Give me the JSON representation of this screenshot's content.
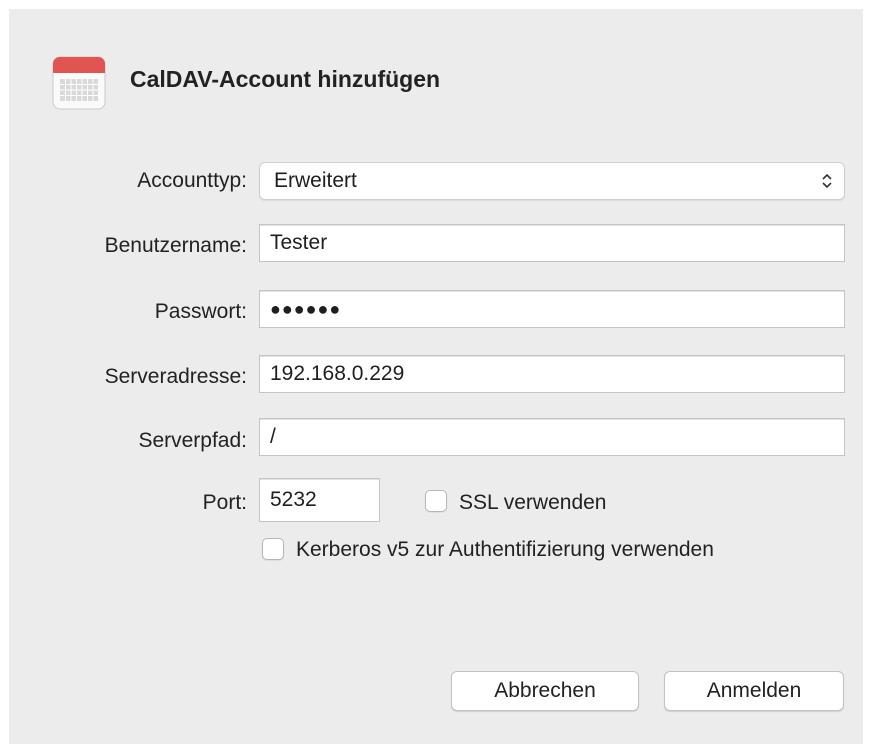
{
  "dialog": {
    "title": "CalDAV-Account hinzufügen",
    "icon": "calendar-icon"
  },
  "form": {
    "account_type": {
      "label": "Accounttyp:",
      "value": "Erweitert"
    },
    "username": {
      "label": "Benutzername:",
      "value": "Tester"
    },
    "password": {
      "label": "Passwort:",
      "value": "●●●●●●"
    },
    "server_address": {
      "label": "Serveradresse:",
      "value": "192.168.0.229"
    },
    "server_path": {
      "label": "Serverpfad:",
      "value": "/"
    },
    "port": {
      "label": "Port:",
      "value": "5232"
    },
    "ssl": {
      "label": "SSL verwenden",
      "checked": false
    },
    "kerberos": {
      "label": "Kerberos v5 zur Authentifizierung verwenden",
      "checked": false
    }
  },
  "buttons": {
    "cancel_label": "Abbrechen",
    "signin_label": "Anmelden"
  },
  "colors": {
    "panel_bg": "#ececec",
    "icon_red": "#e05552"
  }
}
